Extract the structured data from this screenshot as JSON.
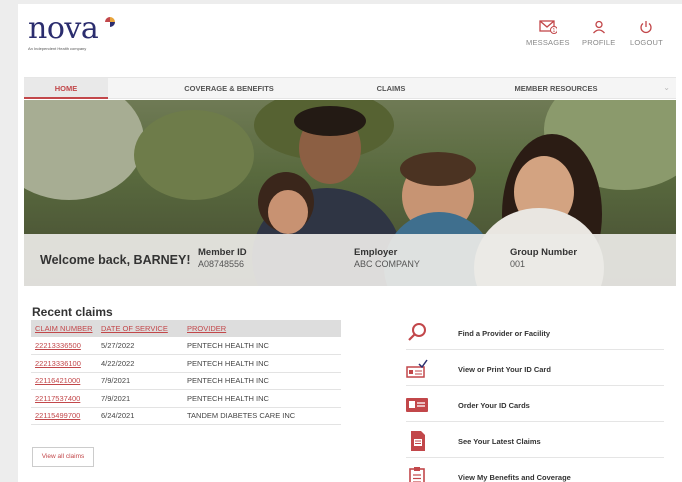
{
  "brand": {
    "name": "nova",
    "tagline": "An Independent Health company",
    "accent": "#c2474a",
    "navy": "#2b2d6e"
  },
  "header": {
    "messages": "MESSAGES",
    "profile": "PROFILE",
    "logout": "LOGOUT"
  },
  "nav": {
    "items": [
      {
        "label": "HOME"
      },
      {
        "label": "COVERAGE & BENEFITS"
      },
      {
        "label": "CLAIMS"
      },
      {
        "label": "MEMBER RESOURCES"
      }
    ]
  },
  "welcome": {
    "greeting": "Welcome back, BARNEY!",
    "member_id_label": "Member ID",
    "member_id": "A08748556",
    "employer_label": "Employer",
    "employer": "ABC COMPANY",
    "group_label": "Group Number",
    "group": "001"
  },
  "recent_claims": {
    "title": "Recent claims",
    "headers": [
      "CLAIM NUMBER",
      "DATE OF SERVICE",
      "PROVIDER"
    ],
    "rows": [
      [
        "22213336500",
        "5/27/2022",
        "PENTECH HEALTH INC"
      ],
      [
        "22213336100",
        "4/22/2022",
        "PENTECH HEALTH INC"
      ],
      [
        "22116421000",
        "7/9/2021",
        "PENTECH HEALTH INC"
      ],
      [
        "22117537400",
        "7/9/2021",
        "PENTECH HEALTH INC"
      ],
      [
        "22115499700",
        "6/24/2021",
        "TANDEM DIABETES CARE INC"
      ]
    ],
    "view_all": "View all claims"
  },
  "quick_links": [
    {
      "label": "Find a Provider or Facility",
      "icon": "search-icon"
    },
    {
      "label": "View or Print Your ID Card",
      "icon": "id-card-print-icon"
    },
    {
      "label": "Order Your ID Cards",
      "icon": "id-card-icon"
    },
    {
      "label": "See Your Latest Claims",
      "icon": "claims-document-icon"
    },
    {
      "label": "View My Benefits and Coverage",
      "icon": "clipboard-icon"
    }
  ]
}
